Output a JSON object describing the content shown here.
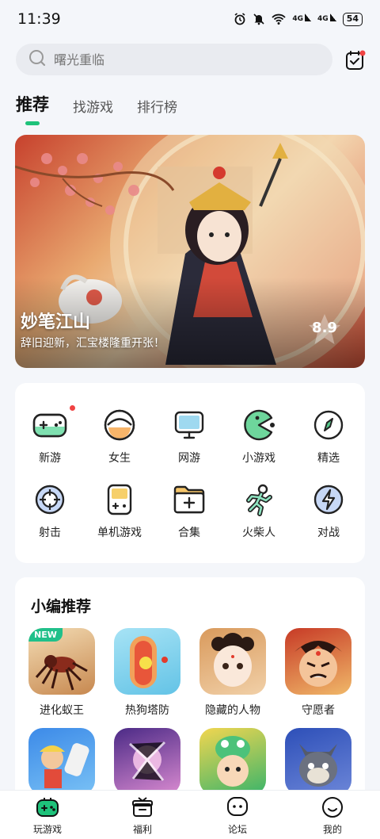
{
  "status_bar": {
    "time": "11:39",
    "network_1": "4G",
    "network_2": "4G",
    "battery": "54"
  },
  "search": {
    "placeholder": "曙光重临"
  },
  "tabs": [
    {
      "label": "推荐",
      "active": true
    },
    {
      "label": "找游戏",
      "active": false
    },
    {
      "label": "排行榜",
      "active": false
    }
  ],
  "banner": {
    "title": "妙笔江山",
    "subtitle": "辞旧迎新，汇宝楼隆重开张！",
    "score": "8.9"
  },
  "categories": [
    {
      "label": "新游",
      "icon": "gamepad-icon",
      "dot": true
    },
    {
      "label": "女生",
      "icon": "girl-face-icon",
      "dot": false
    },
    {
      "label": "网游",
      "icon": "monitor-icon",
      "dot": false
    },
    {
      "label": "小游戏",
      "icon": "pacman-icon",
      "dot": false
    },
    {
      "label": "精选",
      "icon": "compass-icon",
      "dot": false
    },
    {
      "label": "射击",
      "icon": "crosshair-icon",
      "dot": false
    },
    {
      "label": "单机游戏",
      "icon": "handheld-icon",
      "dot": false
    },
    {
      "label": "合集",
      "icon": "folder-plus-icon",
      "dot": false
    },
    {
      "label": "火柴人",
      "icon": "stickman-icon",
      "dot": false
    },
    {
      "label": "对战",
      "icon": "lightning-icon",
      "dot": false
    }
  ],
  "recommend": {
    "title": "小编推荐",
    "games": [
      {
        "name": "进化蚁王",
        "badge": "NEW",
        "colors": [
          "#e7c79a",
          "#7a3b1f"
        ]
      },
      {
        "name": "热狗塔防",
        "badge": "",
        "colors": [
          "#8fd8f0",
          "#f07a3a"
        ]
      },
      {
        "name": "隐藏的人物",
        "badge": "",
        "colors": [
          "#e9a56d",
          "#f6e2c8"
        ]
      },
      {
        "name": "守愿者",
        "badge": "",
        "colors": [
          "#d6452d",
          "#f3c07a"
        ]
      },
      {
        "name": "",
        "badge": "",
        "colors": [
          "#3b8be8",
          "#f4d24a"
        ]
      },
      {
        "name": "",
        "badge": "",
        "colors": [
          "#6a3fb0",
          "#f0a8d6"
        ]
      },
      {
        "name": "",
        "badge": "",
        "colors": [
          "#3ab46a",
          "#f2d650"
        ]
      },
      {
        "name": "",
        "badge": "",
        "colors": [
          "#2d4fb8",
          "#8a9ad8"
        ]
      }
    ]
  },
  "bottom_nav": [
    {
      "label": "玩游戏",
      "icon": "gamepad-nav-icon",
      "active": true
    },
    {
      "label": "福利",
      "icon": "gift-icon",
      "active": false
    },
    {
      "label": "论坛",
      "icon": "chat-icon",
      "active": false
    },
    {
      "label": "我的",
      "icon": "smile-icon",
      "active": false
    }
  ],
  "colors": {
    "accent": "#1ec27a",
    "background": "#f4f6fa",
    "dot": "#f04343"
  }
}
